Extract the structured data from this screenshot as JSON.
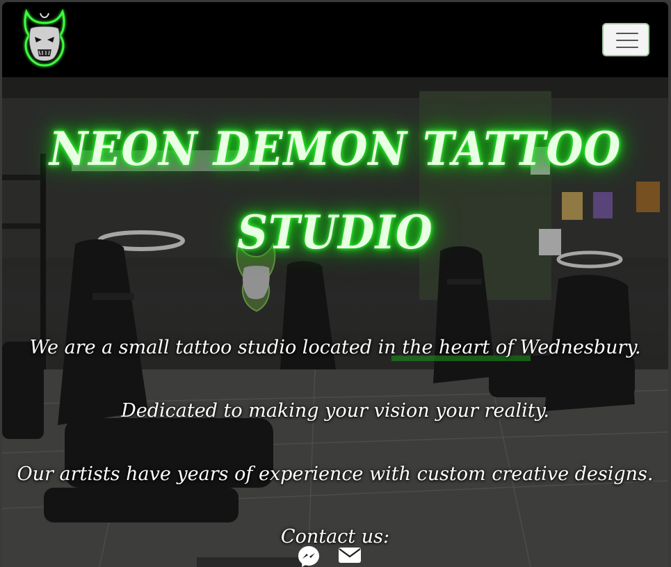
{
  "navbar": {
    "logo_alt": "Neon Demon Tattoo Studio logo",
    "toggle_icon": "hamburger-menu-icon",
    "accent_color": "#39e639"
  },
  "hero": {
    "title_line1": "NEON DEMON TATTOO",
    "title_line2": "STUDIO",
    "paragraphs": [
      "We are a small tattoo studio located in the heart of Wednesbury.",
      "Dedicated to making your vision your reality.",
      "Our artists have years of experience with custom creative designs."
    ],
    "contact_label": "Contact us:",
    "contact_icons": [
      "messenger-icon",
      "envelope-icon"
    ],
    "glow_color": "#2cff2c"
  }
}
